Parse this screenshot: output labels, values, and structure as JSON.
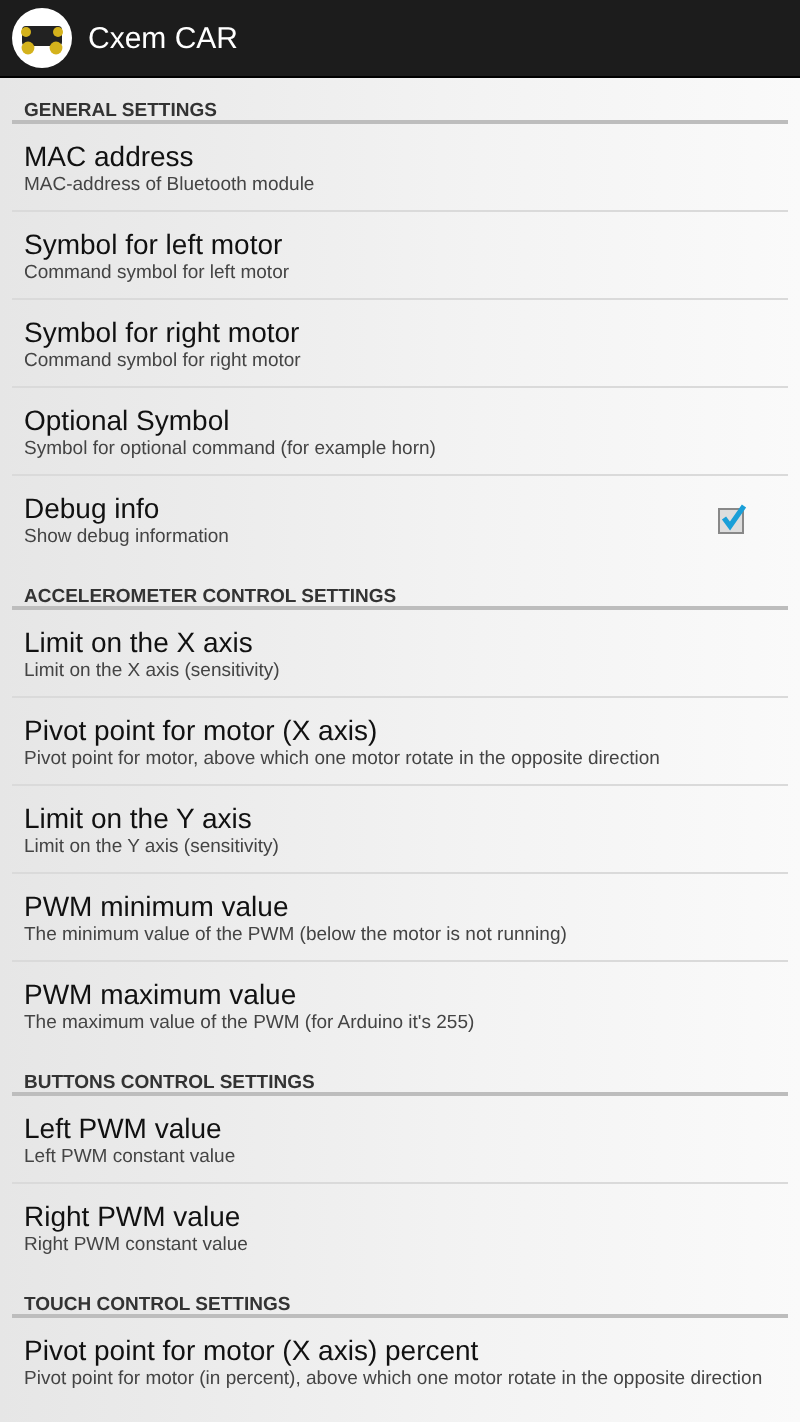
{
  "action_bar": {
    "title": "Cxem CAR"
  },
  "sections": [
    {
      "title": "GENERAL SETTINGS",
      "items": [
        {
          "kind": "text",
          "title": "MAC address",
          "summary": "MAC-address of Bluetooth module"
        },
        {
          "kind": "text",
          "title": "Symbol for left motor",
          "summary": "Command symbol for left motor"
        },
        {
          "kind": "text",
          "title": "Symbol for right motor",
          "summary": "Command symbol for right motor"
        },
        {
          "kind": "text",
          "title": "Optional Symbol",
          "summary": "Symbol for optional command (for example horn)"
        },
        {
          "kind": "checkbox",
          "title": "Debug info",
          "summary": "Show debug information",
          "checked": true
        }
      ]
    },
    {
      "title": "ACCELEROMETER CONTROL SETTINGS",
      "items": [
        {
          "kind": "text",
          "title": "Limit on the X axis",
          "summary": "Limit on the X axis (sensitivity)"
        },
        {
          "kind": "text",
          "title": "Pivot point for motor (X axis)",
          "summary": "Pivot point for motor, above which one motor rotate in the opposite direction"
        },
        {
          "kind": "text",
          "title": "Limit on the Y axis",
          "summary": "Limit on the Y axis (sensitivity)"
        },
        {
          "kind": "text",
          "title": "PWM minimum value",
          "summary": "The minimum value of the PWM (below the motor is not running)"
        },
        {
          "kind": "text",
          "title": "PWM maximum value",
          "summary": "The maximum value of the PWM (for Arduino it's 255)"
        }
      ]
    },
    {
      "title": "BUTTONS CONTROL SETTINGS",
      "items": [
        {
          "kind": "text",
          "title": "Left PWM value",
          "summary": "Left PWM constant value"
        },
        {
          "kind": "text",
          "title": "Right PWM value",
          "summary": "Right PWM constant value"
        }
      ]
    },
    {
      "title": "TOUCH CONTROL SETTINGS",
      "items": [
        {
          "kind": "text",
          "title": "Pivot point for motor (X axis) percent",
          "summary": "Pivot point for motor (in percent), above which one motor rotate in the opposite direction"
        }
      ]
    }
  ]
}
